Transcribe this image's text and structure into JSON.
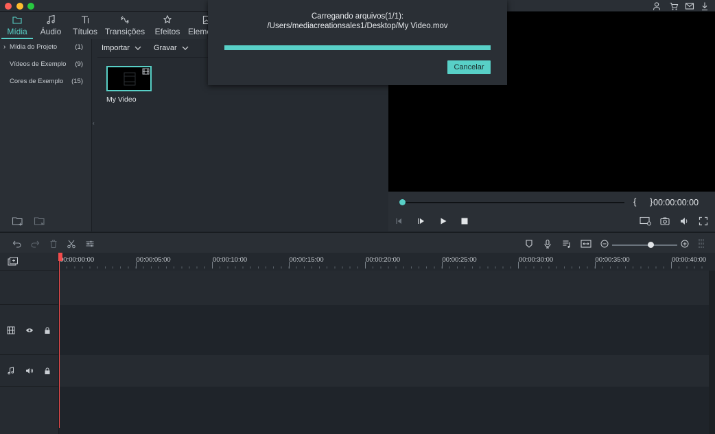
{
  "accent_color": "#58d0c7",
  "playhead_color": "#f24b4b",
  "media_tabs": [
    {
      "label": "Mídia",
      "icon": "folder-icon",
      "active": true
    },
    {
      "label": "Áudio",
      "icon": "music-note-icon",
      "active": false
    },
    {
      "label": "Títulos",
      "icon": "text-title-icon",
      "active": false
    },
    {
      "label": "Transições",
      "icon": "transition-icon",
      "active": false
    },
    {
      "label": "Efeitos",
      "icon": "effects-icon",
      "active": false
    },
    {
      "label": "Eleme",
      "icon": "elements-icon",
      "active": false
    }
  ],
  "library": {
    "items": [
      {
        "label": "Mídia do Projeto",
        "count": "(1)"
      },
      {
        "label": "Vídeos de Exemplo",
        "count": "(9)"
      },
      {
        "label": "Cores de Exemplo",
        "count": "(15)"
      }
    ]
  },
  "media_toolbar": {
    "import_label": "Importar",
    "record_label": "Gravar"
  },
  "media_items": [
    {
      "caption": "My Video"
    }
  ],
  "preview": {
    "braces": "{ }",
    "timecode": "00:00:00:00"
  },
  "ruler": {
    "labels": [
      "00:00:00:00",
      "00:00:05:00",
      "00:00:10:00",
      "00:00:15:00",
      "00:00:20:00",
      "00:00:25:00",
      "00:00:30:00",
      "00:00:35:00",
      "00:00:40:00"
    ]
  },
  "dialog": {
    "title": "Carregando arquivos(1/1):",
    "path": "/Users/mediacreationsales1/Desktop/My Video.mov",
    "progress": 1.0,
    "cancel_label": "Cancelar"
  }
}
